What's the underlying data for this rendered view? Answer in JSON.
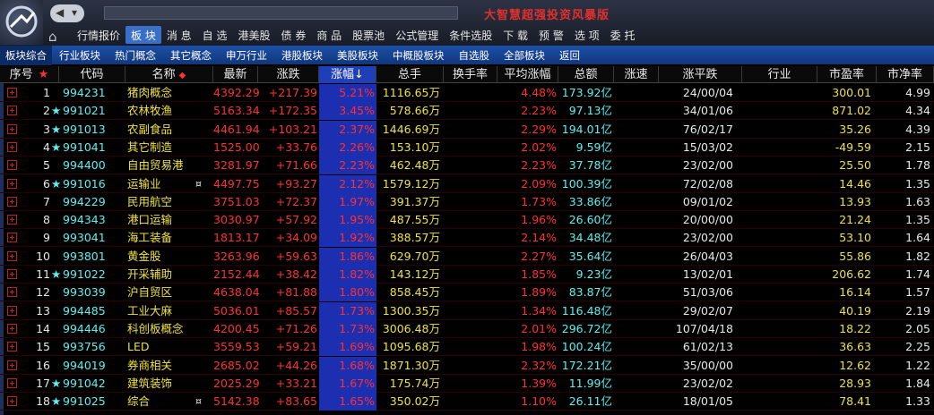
{
  "app": {
    "banner": "大智慧超强投资风暴版",
    "nav_back": "◀",
    "nav_dropdown": "▾",
    "home_icon": "home-icon"
  },
  "menu": [
    {
      "label": "行情报价",
      "active": false
    },
    {
      "label": "板 块",
      "active": true
    },
    {
      "label": "消 息",
      "active": false
    },
    {
      "label": "自 选",
      "active": false
    },
    {
      "label": "港美股",
      "active": false
    },
    {
      "label": "债 券",
      "active": false
    },
    {
      "label": "商 品",
      "active": false
    },
    {
      "label": "股票池",
      "active": false
    },
    {
      "label": "公式管理",
      "active": false
    },
    {
      "label": "条件选股",
      "active": false
    },
    {
      "label": "下 载",
      "active": false
    },
    {
      "label": "预 警",
      "active": false
    },
    {
      "label": "选 项",
      "active": false
    },
    {
      "label": "委 托",
      "active": false
    }
  ],
  "subtabs": [
    "板块综合",
    "行业板块",
    "热门概念",
    "其它概念",
    "申万行业",
    "港股板块",
    "美股板块",
    "中概股板块",
    "自选股",
    "全部板块",
    "返回"
  ],
  "columns": [
    "序号",
    "代码",
    "名称",
    "最新",
    "涨跌",
    "涨幅↓",
    "总手",
    "换手率",
    "平均涨幅",
    "总额",
    "涨速",
    "涨平跌",
    "行业",
    "市盈率",
    "市净率"
  ],
  "header_marks": {
    "seq_star": "★",
    "name_mark": "◆"
  },
  "rows": [
    {
      "seq": "1",
      "star": "",
      "code": "994231",
      "name": "猪肉概念",
      "mark": "",
      "last": "4392.29",
      "chg": "+217.39",
      "pct": "5.21%",
      "vol": "1116.65万",
      "turnover": "",
      "avgpct": "4.48%",
      "amount": "173.92亿",
      "speed": "",
      "updown": "24/00/04",
      "industry": "",
      "pe": "300.01",
      "pb": "4.99"
    },
    {
      "seq": "2",
      "star": "★",
      "code": "991021",
      "name": "农林牧渔",
      "mark": "",
      "last": "5163.34",
      "chg": "+172.35",
      "pct": "3.45%",
      "vol": "578.66万",
      "turnover": "",
      "avgpct": "2.23%",
      "amount": "97.13亿",
      "speed": "",
      "updown": "34/01/06",
      "industry": "",
      "pe": "871.02",
      "pb": "4.34"
    },
    {
      "seq": "3",
      "star": "★",
      "code": "991013",
      "name": "农副食品",
      "mark": "",
      "last": "4461.94",
      "chg": "+103.21",
      "pct": "2.37%",
      "vol": "1446.69万",
      "turnover": "",
      "avgpct": "2.29%",
      "amount": "194.01亿",
      "speed": "",
      "updown": "76/02/17",
      "industry": "",
      "pe": "35.26",
      "pb": "4.39"
    },
    {
      "seq": "4",
      "star": "★",
      "code": "991041",
      "name": "其它制造",
      "mark": "",
      "last": "1525.00",
      "chg": "+33.76",
      "pct": "2.26%",
      "vol": "153.10万",
      "turnover": "",
      "avgpct": "2.02%",
      "amount": "9.59亿",
      "speed": "",
      "updown": "15/03/02",
      "industry": "",
      "pe": "-49.59",
      "pb": "2.15"
    },
    {
      "seq": "5",
      "star": "",
      "code": "994400",
      "name": "自由贸易港",
      "mark": "",
      "last": "3281.97",
      "chg": "+71.66",
      "pct": "2.23%",
      "vol": "462.48万",
      "turnover": "",
      "avgpct": "2.23%",
      "amount": "37.78亿",
      "speed": "",
      "updown": "23/02/00",
      "industry": "",
      "pe": "25.50",
      "pb": "1.78"
    },
    {
      "seq": "6",
      "star": "★",
      "code": "991016",
      "name": "运输业",
      "mark": "¤",
      "last": "4497.75",
      "chg": "+93.27",
      "pct": "2.12%",
      "vol": "1579.12万",
      "turnover": "",
      "avgpct": "2.09%",
      "amount": "100.39亿",
      "speed": "",
      "updown": "72/02/08",
      "industry": "",
      "pe": "14.46",
      "pb": "1.35"
    },
    {
      "seq": "7",
      "star": "",
      "code": "994229",
      "name": "民用航空",
      "mark": "",
      "last": "3751.03",
      "chg": "+72.37",
      "pct": "1.97%",
      "vol": "391.37万",
      "turnover": "",
      "avgpct": "1.73%",
      "amount": "33.86亿",
      "speed": "",
      "updown": "09/01/02",
      "industry": "",
      "pe": "13.93",
      "pb": "1.63"
    },
    {
      "seq": "8",
      "star": "",
      "code": "994343",
      "name": "港口运输",
      "mark": "",
      "last": "3030.97",
      "chg": "+57.92",
      "pct": "1.95%",
      "vol": "487.55万",
      "turnover": "",
      "avgpct": "1.96%",
      "amount": "26.60亿",
      "speed": "",
      "updown": "20/00/00",
      "industry": "",
      "pe": "21.24",
      "pb": "1.35"
    },
    {
      "seq": "9",
      "star": "",
      "code": "993041",
      "name": "海工装备",
      "mark": "",
      "last": "1813.17",
      "chg": "+34.09",
      "pct": "1.92%",
      "vol": "388.57万",
      "turnover": "",
      "avgpct": "2.14%",
      "amount": "34.48亿",
      "speed": "",
      "updown": "23/02/00",
      "industry": "",
      "pe": "53.10",
      "pb": "1.64"
    },
    {
      "seq": "10",
      "star": "",
      "code": "993801",
      "name": "黄金股",
      "mark": "",
      "last": "3263.96",
      "chg": "+59.63",
      "pct": "1.86%",
      "vol": "629.70万",
      "turnover": "",
      "avgpct": "2.27%",
      "amount": "35.64亿",
      "speed": "",
      "updown": "26/04/03",
      "industry": "",
      "pe": "55.86",
      "pb": "1.82"
    },
    {
      "seq": "11",
      "star": "★",
      "code": "991022",
      "name": "开采辅助",
      "mark": "",
      "last": "2152.44",
      "chg": "+38.42",
      "pct": "1.82%",
      "vol": "143.12万",
      "turnover": "",
      "avgpct": "1.85%",
      "amount": "9.23亿",
      "speed": "",
      "updown": "13/02/01",
      "industry": "",
      "pe": "206.62",
      "pb": "1.74"
    },
    {
      "seq": "12",
      "star": "",
      "code": "993039",
      "name": "沪自贸区",
      "mark": "",
      "last": "4638.04",
      "chg": "+81.88",
      "pct": "1.80%",
      "vol": "858.45万",
      "turnover": "",
      "avgpct": "1.89%",
      "amount": "83.87亿",
      "speed": "",
      "updown": "51/03/06",
      "industry": "",
      "pe": "16.14",
      "pb": "1.57"
    },
    {
      "seq": "13",
      "star": "",
      "code": "994485",
      "name": "工业大麻",
      "mark": "",
      "last": "5036.01",
      "chg": "+85.57",
      "pct": "1.73%",
      "vol": "1300.35万",
      "turnover": "",
      "avgpct": "1.34%",
      "amount": "116.48亿",
      "speed": "",
      "updown": "29/02/07",
      "industry": "",
      "pe": "40.19",
      "pb": "2.19"
    },
    {
      "seq": "14",
      "star": "",
      "code": "994446",
      "name": "科创板概念",
      "mark": "",
      "last": "4200.45",
      "chg": "+71.26",
      "pct": "1.73%",
      "vol": "3006.48万",
      "turnover": "",
      "avgpct": "2.01%",
      "amount": "296.72亿",
      "speed": "",
      "updown": "107/04/18",
      "industry": "",
      "pe": "18.22",
      "pb": "2.05"
    },
    {
      "seq": "15",
      "star": "",
      "code": "993756",
      "name": "LED",
      "mark": "",
      "last": "3559.53",
      "chg": "+59.21",
      "pct": "1.69%",
      "vol": "1095.68万",
      "turnover": "",
      "avgpct": "1.98%",
      "amount": "100.24亿",
      "speed": "",
      "updown": "61/02/13",
      "industry": "",
      "pe": "36.63",
      "pb": "2.25"
    },
    {
      "seq": "16",
      "star": "",
      "code": "994019",
      "name": "券商相关",
      "mark": "",
      "last": "2685.02",
      "chg": "+44.26",
      "pct": "1.68%",
      "vol": "1871.30万",
      "turnover": "",
      "avgpct": "2.32%",
      "amount": "172.21亿",
      "speed": "",
      "updown": "35/00/00",
      "industry": "",
      "pe": "12.62",
      "pb": "1.22"
    },
    {
      "seq": "17",
      "star": "★",
      "code": "991042",
      "name": "建筑装饰",
      "mark": "",
      "last": "2025.29",
      "chg": "+33.21",
      "pct": "1.67%",
      "vol": "175.74万",
      "turnover": "",
      "avgpct": "1.39%",
      "amount": "11.99亿",
      "speed": "",
      "updown": "23/02/02",
      "industry": "",
      "pe": "28.93",
      "pb": "1.84"
    },
    {
      "seq": "18",
      "star": "★",
      "code": "991025",
      "name": "综合",
      "mark": "¤",
      "last": "5142.38",
      "chg": "+83.65",
      "pct": "1.65%",
      "vol": "350.02万",
      "turnover": "",
      "avgpct": "1.10%",
      "amount": "26.11亿",
      "speed": "",
      "updown": "18/01/05",
      "industry": "",
      "pe": "78.41",
      "pb": "1.33"
    }
  ],
  "colors": {
    "up": "#ff3030",
    "highlight": "#f0e040",
    "code": "#5ef0f0",
    "sort_column": "#1b2fb0"
  }
}
